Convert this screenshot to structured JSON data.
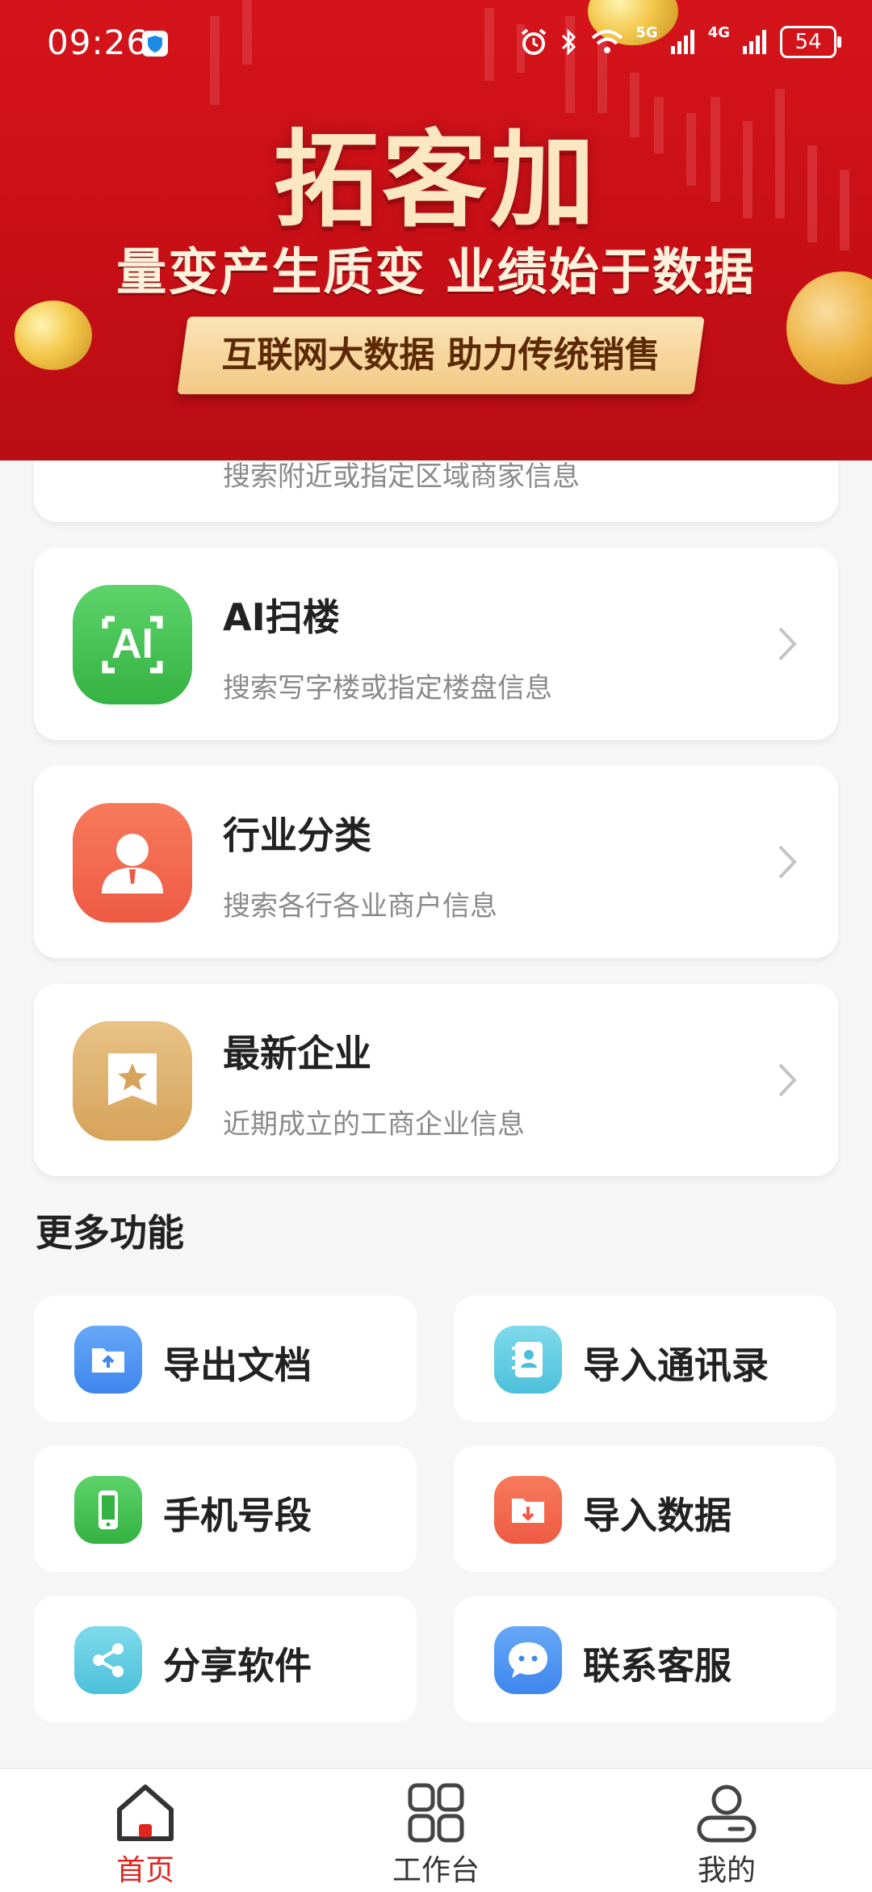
{
  "status_bar": {
    "time": "09:26",
    "battery": "54",
    "net1": "5G",
    "net2": "4G"
  },
  "banner": {
    "title": "拓客加",
    "subtitle": "量变产生质变 业绩始于数据",
    "ribbon": "互联网大数据 助力传统销售"
  },
  "features": [
    {
      "title": "",
      "desc": "搜索附近或指定区域商家信息",
      "icon": "map-icon"
    },
    {
      "title": "AI扫楼",
      "desc": "搜索写字楼或指定楼盘信息",
      "icon": "ai-icon",
      "icon_text": "AI"
    },
    {
      "title": "行业分类",
      "desc": "搜索各行各业商户信息",
      "icon": "person-icon"
    },
    {
      "title": "最新企业",
      "desc": "近期成立的工商企业信息",
      "icon": "star-badge-icon"
    }
  ],
  "more": {
    "title": "更多功能",
    "items": [
      {
        "label": "导出文档",
        "icon": "folder-upload-icon"
      },
      {
        "label": "导入通讯录",
        "icon": "contacts-icon"
      },
      {
        "label": "手机号段",
        "icon": "phone-icon"
      },
      {
        "label": "导入数据",
        "icon": "folder-download-icon"
      },
      {
        "label": "分享软件",
        "icon": "share-icon"
      },
      {
        "label": "联系客服",
        "icon": "chat-icon"
      }
    ]
  },
  "nav": {
    "items": [
      {
        "label": "首页",
        "active": true
      },
      {
        "label": "工作台",
        "active": false
      },
      {
        "label": "我的",
        "active": false
      }
    ],
    "active_color": "#e0261f",
    "inactive_color": "#333333"
  },
  "colors": {
    "brand_red": "#d4141a",
    "green": "#43c14f",
    "orange": "#f0604a",
    "gold": "#d9aa62",
    "blue": "#4a8ff0",
    "cyan": "#5ccbe0"
  }
}
